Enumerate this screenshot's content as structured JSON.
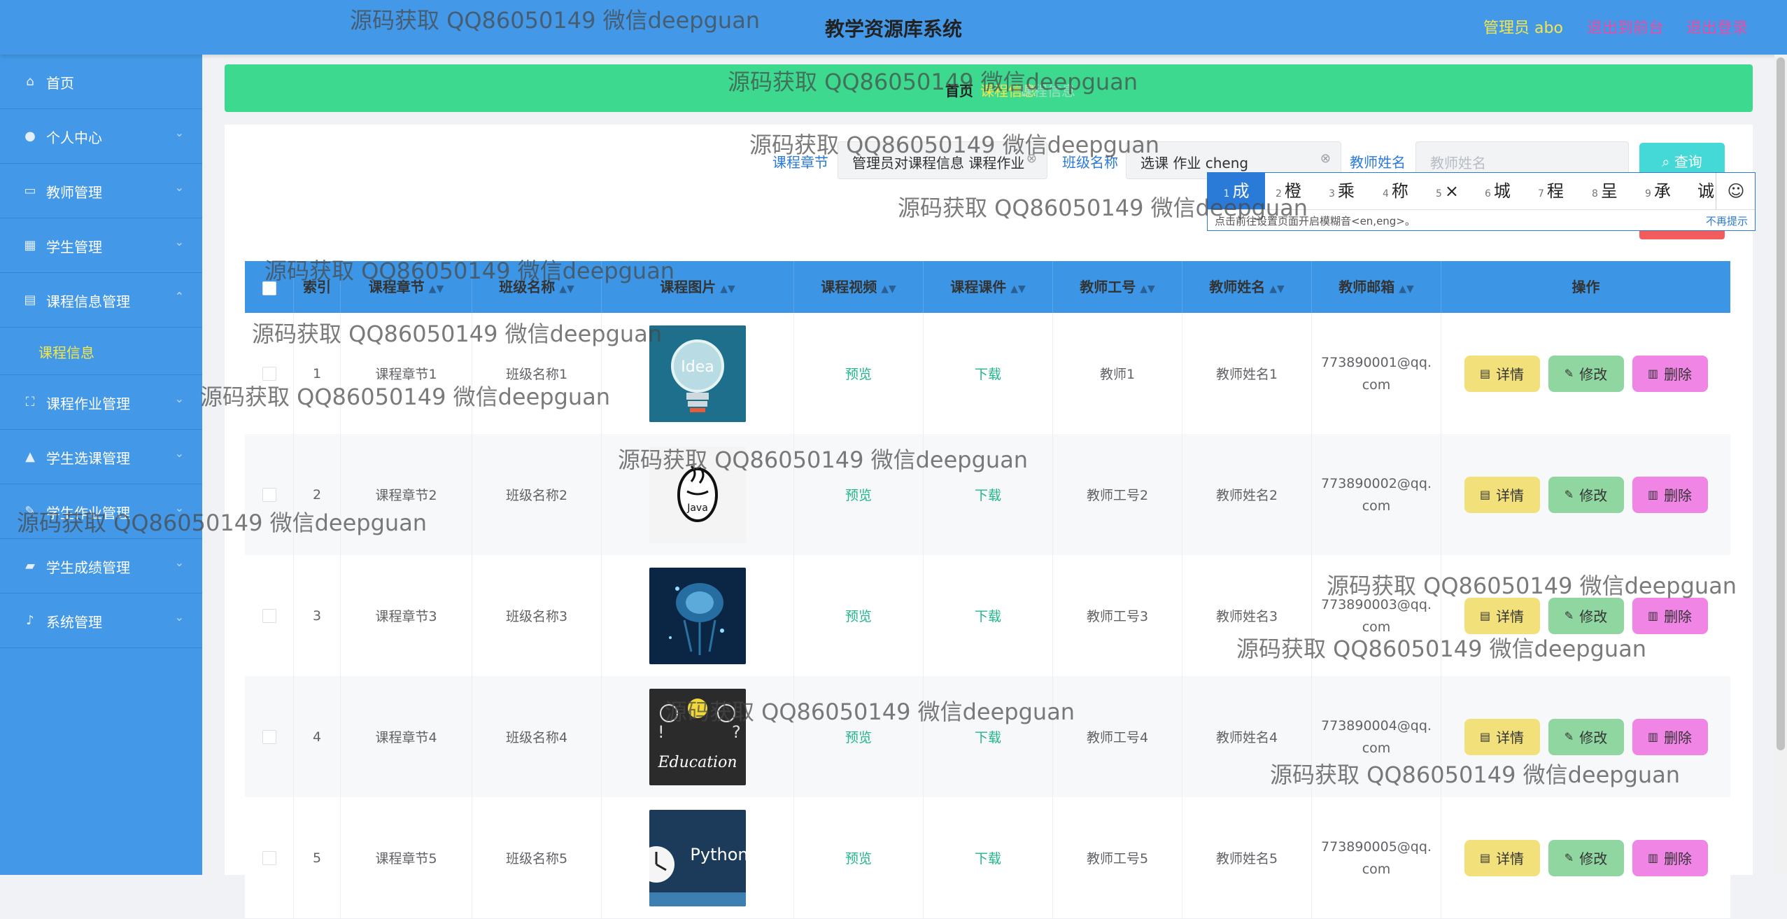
{
  "header": {
    "app_title": "教学资源库系统",
    "user_label": "管理员 abo",
    "back_front_label": "退出到前台",
    "logout_label": "退出登录"
  },
  "sidebar": {
    "items": [
      {
        "icon": "home-icon",
        "label": "首页"
      },
      {
        "icon": "user-icon",
        "label": "个人中心"
      },
      {
        "icon": "monitor-icon",
        "label": "教师管理"
      },
      {
        "icon": "grid-icon",
        "label": "学生管理"
      },
      {
        "icon": "clipboard-icon",
        "label": "课程信息管理"
      },
      {
        "icon": "fullscreen-icon",
        "label": "课程作业管理"
      },
      {
        "icon": "thumbs-up-icon",
        "label": "学生选课管理"
      },
      {
        "icon": "edit-icon",
        "label": "学生作业管理"
      },
      {
        "icon": "folder-icon",
        "label": "学生成绩管理"
      },
      {
        "icon": "mic-icon",
        "label": "系统管理"
      }
    ],
    "sub_item": "课程信息"
  },
  "breadcrumb": {
    "home": "首页",
    "current": "课程信息",
    "extra": "课程信息"
  },
  "search": {
    "chapter_label": "课程章节",
    "chapter_value": "管理员对课程信息  课程作业",
    "class_label": "班级名称",
    "class_value": "选课  作业  cheng",
    "teacher_label": "教师姓名",
    "teacher_placeholder": "教师姓名",
    "search_button": "查询"
  },
  "ime": {
    "candidates": [
      {
        "n": "1",
        "c": "成"
      },
      {
        "n": "2",
        "c": "橙"
      },
      {
        "n": "3",
        "c": "乘"
      },
      {
        "n": "4",
        "c": "称"
      },
      {
        "n": "5",
        "c": "×"
      },
      {
        "n": "6",
        "c": "城"
      },
      {
        "n": "7",
        "c": "程"
      },
      {
        "n": "8",
        "c": "呈"
      },
      {
        "n": "9",
        "c": "承"
      },
      {
        "n": "",
        "c": "诚"
      }
    ],
    "emoji": "☺",
    "hint": "点击前往设置页面开启模糊音<en,eng>。",
    "dismiss": "不再提示"
  },
  "table": {
    "headers": [
      "索引",
      "课程章节",
      "班级名称",
      "课程图片",
      "课程视频",
      "课程课件",
      "教师工号",
      "教师姓名",
      "教师邮箱",
      "操作"
    ],
    "rows": [
      {
        "index": "1",
        "chapter": "课程章节1",
        "class": "班级名称1",
        "image": "idea-bulb",
        "video": "预览",
        "courseware": "下载",
        "teacher_id": "教师1",
        "teacher_name": "教师姓名1",
        "email_a": "773890001@qq.",
        "email_b": "com"
      },
      {
        "index": "2",
        "chapter": "课程章节2",
        "class": "班级名称2",
        "image": "java-logo",
        "video": "预览",
        "courseware": "下载",
        "teacher_id": "教师工号2",
        "teacher_name": "教师姓名2",
        "email_a": "773890002@qq.",
        "email_b": "com"
      },
      {
        "index": "3",
        "chapter": "课程章节3",
        "class": "班级名称3",
        "image": "ai-brain",
        "video": "预览",
        "courseware": "下载",
        "teacher_id": "教师工号3",
        "teacher_name": "教师姓名3",
        "email_a": "773890003@qq.",
        "email_b": "com"
      },
      {
        "index": "4",
        "chapter": "课程章节4",
        "class": "班级名称4",
        "image": "education-chalkboard",
        "video": "预览",
        "courseware": "下载",
        "teacher_id": "教师工号4",
        "teacher_name": "教师姓名4",
        "email_a": "773890004@qq.",
        "email_b": "com"
      },
      {
        "index": "5",
        "chapter": "课程章节5",
        "class": "班级名称5",
        "image": "python-clock",
        "video": "预览",
        "courseware": "下载",
        "teacher_id": "教师工号5",
        "teacher_name": "教师姓名5",
        "email_a": "773890005@qq.",
        "email_b": "com"
      }
    ],
    "actions": {
      "detail": "详情",
      "edit": "修改",
      "delete": "删除"
    },
    "image_texts": {
      "idea": "Idea",
      "java": "Java",
      "education": "Education",
      "python": "Python"
    }
  },
  "watermark": "源码获取 QQ86050149 微信deepguan",
  "colors": {
    "header_bg": "#4399e8",
    "sidebar_bg": "#4399e8",
    "banner_bg": "#3cd98f",
    "table_header_bg": "#3d96e5",
    "detail_btn": "#f2e17a",
    "edit_btn": "#8fd6a1",
    "delete_btn": "#f085e6",
    "search_btn": "#44d8d7"
  }
}
